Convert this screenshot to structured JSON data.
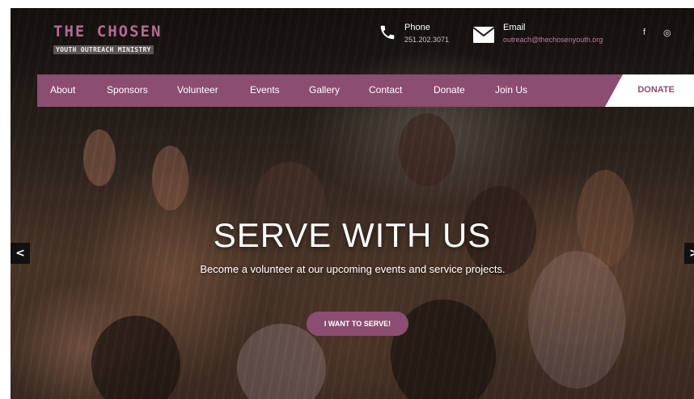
{
  "brand": {
    "title": "THE CHOSEN",
    "subtitle": "YOUTH OUTREACH MINISTRY"
  },
  "contact": {
    "phone_label": "Phone",
    "phone_value": "251.202.3071",
    "email_label": "Email",
    "email_value": "outreach@thechosenyouth.org"
  },
  "social": {
    "facebook": "f",
    "instagram": "◎"
  },
  "nav": {
    "items": [
      "About",
      "Sponsors",
      "Volunteer",
      "Events",
      "Gallery",
      "Contact",
      "Donate",
      "Join Us"
    ],
    "donate_button": "DONATE"
  },
  "hero": {
    "title": "SERVE WITH US",
    "subtitle": "Become a volunteer at our upcoming events and service projects.",
    "cta_label": "I WANT TO SERVE!",
    "prev_arrow": "<",
    "next_arrow": ">"
  },
  "colors": {
    "accent": "#8b4d71",
    "logo": "#b56a92",
    "link": "#c17a9f"
  },
  "icons": {
    "phone": "phone-icon",
    "email": "envelope-icon",
    "facebook": "facebook-icon",
    "instagram": "instagram-icon"
  }
}
